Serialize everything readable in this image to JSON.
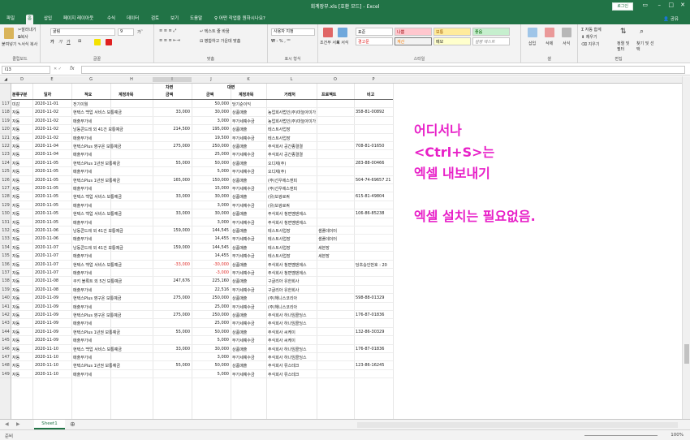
{
  "window": {
    "title": "회계장부.xls [호환 모드] - Excel",
    "login": "로그인"
  },
  "tabs": [
    "파일",
    "홈",
    "삽입",
    "페이지 레이아웃",
    "수식",
    "데이터",
    "검토",
    "보기",
    "도움말",
    "어떤 작업을 원하시나요?"
  ],
  "share": "공유",
  "ribbon": {
    "clipboard": {
      "label": "클립보드",
      "paste": "붙여넣기",
      "cut": "잘라내기",
      "copy": "복사",
      "format_painter": "서식 복사"
    },
    "font": {
      "label": "글꼴",
      "name": "굴림",
      "size": "9",
      "bold": "가",
      "italic": "가",
      "underline": "가"
    },
    "alignment": {
      "label": "맞춤",
      "wrap": "텍스트 줄 바꿈",
      "merge": "병합하고 가운데 맞춤"
    },
    "number": {
      "label": "표시 형식",
      "format": "사용자 지정"
    },
    "styles": {
      "label": "스타일",
      "cond": "조건부 서식",
      "table": "표 서식",
      "cells": [
        "표준",
        "나쁨",
        "보통",
        "좋음",
        "경고문",
        "계산",
        "메모",
        "설명 텍스트"
      ]
    },
    "cells": {
      "label": "셀",
      "insert": "삽입",
      "delete": "삭제",
      "format": "서식"
    },
    "editing": {
      "label": "편집",
      "autosum": "자동 합계",
      "fill": "채우기",
      "clear": "지우기",
      "sort": "정렬 및 필터",
      "find": "찾기 및 선택"
    }
  },
  "formula_bar": {
    "name_box": "I13",
    "fx": "fx",
    "formula": ""
  },
  "columns": [
    "D",
    "E",
    "G",
    "H",
    "I",
    "J",
    "K",
    "L",
    "O",
    "P"
  ],
  "sheet": {
    "group_headers": {
      "debit": "차변",
      "credit": "대변"
    },
    "headers": {
      "type": "분류구분",
      "date": "일자",
      "desc": "적요",
      "debit_account": "계정과목",
      "debit_amount": "금액",
      "credit_amount": "금액",
      "credit_account": "계정과목",
      "partner": "거래처",
      "project": "프로젝트",
      "memo": "비고"
    },
    "rows": [
      {
        "n": "117",
        "type": "미감",
        "date": "2020-11-01",
        "desc": "전기이월",
        "dacc": "",
        "damt": "",
        "camt": "50,000",
        "cacc": "당기순이익",
        "partner": "",
        "proj": "",
        "memo": ""
      },
      {
        "n": "118",
        "type": "자동",
        "date": "2020-11-02",
        "desc": "현택스 백업 서비스 보통예금",
        "dacc": "",
        "damt": "33,000",
        "camt": "30,000",
        "cacc": "상품매출",
        "partner": "농업회사법인(주)마늘아미가",
        "proj": "",
        "memo": "358-81-00892"
      },
      {
        "n": "119",
        "type": "자동",
        "date": "2020-11-02",
        "desc": "매출부가세",
        "dacc": "",
        "damt": "",
        "camt": "3,000",
        "cacc": "부가세예수금",
        "partner": "농업회사법인(주)마늘아미가",
        "proj": "",
        "memo": ""
      },
      {
        "n": "120",
        "type": "자동",
        "date": "2020-11-02",
        "desc": "낭동콘드레 외 41건 보통예금",
        "dacc": "",
        "damt": "214,500",
        "camt": "195,000",
        "cacc": "상품매출",
        "partner": "테스트사업장",
        "proj": "",
        "memo": ""
      },
      {
        "n": "121",
        "type": "자동",
        "date": "2020-11-02",
        "desc": "매출부가세",
        "dacc": "",
        "damt": "",
        "camt": "19,500",
        "cacc": "부가세예수금",
        "partner": "테스트사업장",
        "proj": "",
        "memo": ""
      },
      {
        "n": "122",
        "type": "자동",
        "date": "2020-11-04",
        "desc": "현택스Plus 영구온 보통예금",
        "dacc": "",
        "damt": "275,000",
        "camt": "250,000",
        "cacc": "상품매출",
        "partner": "주식회사 공간종결결",
        "proj": "",
        "memo": "708-81-01650"
      },
      {
        "n": "123",
        "type": "자동",
        "date": "2020-11-04",
        "desc": "매출부가세",
        "dacc": "",
        "damt": "",
        "camt": "25,000",
        "cacc": "부가세예수금",
        "partner": "주식회사 공간종결결",
        "proj": "",
        "memo": ""
      },
      {
        "n": "124",
        "type": "자동",
        "date": "2020-11-05",
        "desc": "현택스Plus 1년권 보통예금",
        "dacc": "",
        "damt": "55,000",
        "camt": "50,000",
        "cacc": "상품매출",
        "partner": "오디제(주)",
        "proj": "",
        "memo": "283-88-00466"
      },
      {
        "n": "125",
        "type": "자동",
        "date": "2020-11-05",
        "desc": "매출부가세",
        "dacc": "",
        "damt": "",
        "camt": "5,000",
        "cacc": "부가세예수금",
        "partner": "오디제(주)",
        "proj": "",
        "memo": ""
      },
      {
        "n": "126",
        "type": "자동",
        "date": "2020-11-05",
        "desc": "현택스Plus 1년권 보통예금",
        "dacc": "",
        "damt": "165,000",
        "camt": "150,000",
        "cacc": "상품매출",
        "partner": "(주)선우에스엔피",
        "proj": "",
        "memo": "504-74-69657 21"
      },
      {
        "n": "127",
        "type": "자동",
        "date": "2020-11-05",
        "desc": "매출부가세",
        "dacc": "",
        "damt": "",
        "camt": "15,000",
        "cacc": "부가세예수금",
        "partner": "(주)선우에스엔피",
        "proj": "",
        "memo": ""
      },
      {
        "n": "128",
        "type": "자동",
        "date": "2020-11-05",
        "desc": "현택스 백업 서비스 보통예금",
        "dacc": "",
        "damt": "33,000",
        "camt": "30,000",
        "cacc": "상품매출",
        "partner": "(유)보광로쿼",
        "proj": "",
        "memo": "615-81-49804"
      },
      {
        "n": "129",
        "type": "자동",
        "date": "2020-11-05",
        "desc": "매출부가세",
        "dacc": "",
        "damt": "",
        "camt": "3,000",
        "cacc": "부가세예수금",
        "partner": "(유)보광로쿼",
        "proj": "",
        "memo": ""
      },
      {
        "n": "130",
        "type": "자동",
        "date": "2020-11-05",
        "desc": "현택스 백업 서비스 보통예금",
        "dacc": "",
        "damt": "33,000",
        "camt": "30,000",
        "cacc": "상품매출",
        "partner": "주식회사 청면멤덴에스",
        "proj": "",
        "memo": "106-86-85238"
      },
      {
        "n": "131",
        "type": "자동",
        "date": "2020-11-05",
        "desc": "매출부가세",
        "dacc": "",
        "damt": "",
        "camt": "3,000",
        "cacc": "부가세예수금",
        "partner": "주식회사 청면멤덴에스",
        "proj": "",
        "memo": ""
      },
      {
        "n": "132",
        "type": "자동",
        "date": "2020-11-06",
        "desc": "낭동콘드레 외 41건 보통예금",
        "dacc": "",
        "damt": "159,000",
        "camt": "144,545",
        "cacc": "상품매출",
        "partner": "테스트사업장",
        "proj": "샘플데이터",
        "memo": ""
      },
      {
        "n": "133",
        "type": "자동",
        "date": "2020-11-06",
        "desc": "매출부가세",
        "dacc": "",
        "damt": "",
        "camt": "14,455",
        "cacc": "부가세예수금",
        "partner": "테스트사업장",
        "proj": "샘플데이터",
        "memo": ""
      },
      {
        "n": "134",
        "type": "자동",
        "date": "2020-11-07",
        "desc": "낭동콘드레 외 41건 보통예금",
        "dacc": "",
        "damt": "159,000",
        "camt": "144,545",
        "cacc": "상품매출",
        "partner": "테스트사업장",
        "proj": "세븐장",
        "memo": ""
      },
      {
        "n": "135",
        "type": "자동",
        "date": "2020-11-07",
        "desc": "매출부가세",
        "dacc": "",
        "damt": "",
        "camt": "14,455",
        "cacc": "부가세예수금",
        "partner": "테스트사업장",
        "proj": "세븐장",
        "memo": ""
      },
      {
        "n": "136",
        "type": "자동",
        "date": "2020-11-07",
        "desc": "현택스 백업 서비스 보통예금",
        "dacc": "",
        "damt": "-33,000",
        "camt": "-30,000",
        "cacc": "상품매출",
        "partner": "주식회사 청면멤덴에스",
        "proj": "",
        "memo": "당초승인번호 : 20"
      },
      {
        "n": "137",
        "type": "자동",
        "date": "2020-11-07",
        "desc": "매출부가세",
        "dacc": "",
        "damt": "",
        "camt": "-3,000",
        "cacc": "부가세예수금",
        "partner": "주식회사 청면멤덴에스",
        "proj": "",
        "memo": ""
      },
      {
        "n": "138",
        "type": "자동",
        "date": "2020-11-08",
        "desc": "쿠키 블록트 외 5건 보통예금",
        "dacc": "",
        "damt": "247,676",
        "camt": "225,160",
        "cacc": "상품매출",
        "partner": "구글리아 유한회사",
        "proj": "",
        "memo": ""
      },
      {
        "n": "139",
        "type": "자동",
        "date": "2020-11-08",
        "desc": "매출부가세",
        "dacc": "",
        "damt": "",
        "camt": "22,516",
        "cacc": "부가세예수금",
        "partner": "구글리아 유한회사",
        "proj": "",
        "memo": ""
      },
      {
        "n": "140",
        "type": "자동",
        "date": "2020-11-09",
        "desc": "현택스Plus 영구온 보통예금",
        "dacc": "",
        "damt": "275,000",
        "camt": "250,000",
        "cacc": "상품매출",
        "partner": "(주)해니스코리아",
        "proj": "",
        "memo": "598-88-01329"
      },
      {
        "n": "141",
        "type": "자동",
        "date": "2020-11-09",
        "desc": "매출부가세",
        "dacc": "",
        "damt": "",
        "camt": "25,000",
        "cacc": "부가세예수금",
        "partner": "(주)해니스코리아",
        "proj": "",
        "memo": ""
      },
      {
        "n": "142",
        "type": "자동",
        "date": "2020-11-09",
        "desc": "현택스Plus 영구온 보통예금",
        "dacc": "",
        "damt": "275,000",
        "camt": "250,000",
        "cacc": "상품매출",
        "partner": "주식회사 하나임콜딩스",
        "proj": "",
        "memo": "176-87-01836"
      },
      {
        "n": "143",
        "type": "자동",
        "date": "2020-11-09",
        "desc": "매출부가세",
        "dacc": "",
        "damt": "",
        "camt": "25,000",
        "cacc": "부가세예수금",
        "partner": "주식회사 하나임콜딩스",
        "proj": "",
        "memo": ""
      },
      {
        "n": "144",
        "type": "자동",
        "date": "2020-11-09",
        "desc": "현택스Plus 1년권 보통예금",
        "dacc": "",
        "damt": "55,000",
        "camt": "50,000",
        "cacc": "상품매출",
        "partner": "주식회사 씨케이",
        "proj": "",
        "memo": "132-86-30329"
      },
      {
        "n": "145",
        "type": "자동",
        "date": "2020-11-09",
        "desc": "매출부가세",
        "dacc": "",
        "damt": "",
        "camt": "5,000",
        "cacc": "부가세예수금",
        "partner": "주식회사 씨케이",
        "proj": "",
        "memo": ""
      },
      {
        "n": "146",
        "type": "자동",
        "date": "2020-11-10",
        "desc": "현택스 백업 서비스 보통예금",
        "dacc": "",
        "damt": "33,000",
        "camt": "30,000",
        "cacc": "상품매출",
        "partner": "주식회사 하나임콜딩스",
        "proj": "",
        "memo": "176-87-01836"
      },
      {
        "n": "147",
        "type": "자동",
        "date": "2020-11-10",
        "desc": "매출부가세",
        "dacc": "",
        "damt": "",
        "camt": "3,000",
        "cacc": "부가세예수금",
        "partner": "주식회사 하나임콜딩스",
        "proj": "",
        "memo": ""
      },
      {
        "n": "148",
        "type": "자동",
        "date": "2020-11-10",
        "desc": "현택스Plus 1년권 보통예금",
        "dacc": "",
        "damt": "55,000",
        "camt": "50,000",
        "cacc": "상품매출",
        "partner": "주식회사 뮤스테크",
        "proj": "",
        "memo": "123-86-16245"
      },
      {
        "n": "149",
        "type": "자동",
        "date": "2020-11-10",
        "desc": "매출부가세",
        "dacc": "",
        "damt": "",
        "camt": "5,000",
        "cacc": "부가세예수금",
        "partner": "주식회사 뮤스테크",
        "proj": "",
        "memo": ""
      }
    ]
  },
  "overlay": {
    "lines": [
      "어디서나",
      "<Ctrl+S>는",
      "엑셀 내보내기",
      "",
      "엑셀 설치는 필요없음."
    ],
    "color": "#e820c8"
  },
  "sheet_tab": "Sheet1",
  "status": {
    "ready": "준비",
    "zoom": "100%"
  },
  "colors": {
    "excel_green": "#217346",
    "negative": "#e0302c"
  }
}
